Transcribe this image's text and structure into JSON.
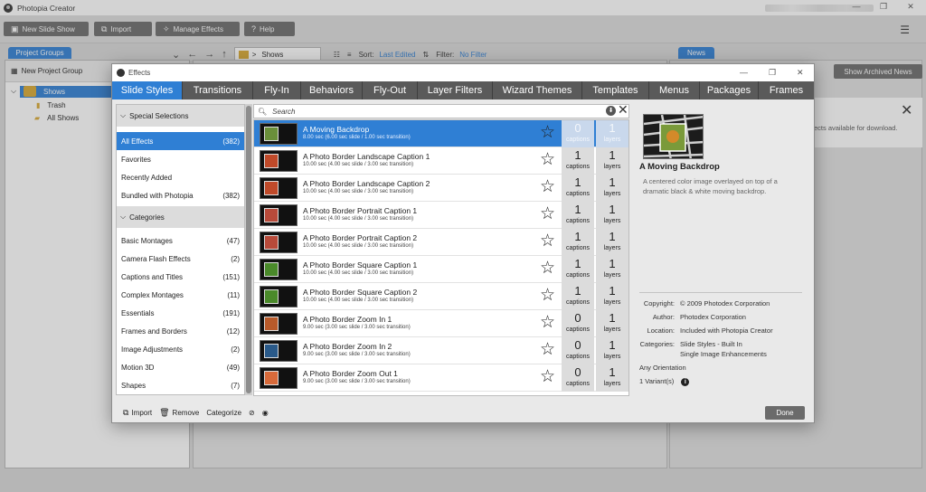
{
  "app": {
    "title": "Photopia Creator",
    "window_controls": {
      "minimize": "—",
      "maximize": "❐",
      "close": "✕"
    }
  },
  "toolbar": {
    "new_slide_show": "New Slide Show",
    "import": "Import",
    "manage_effects": "Manage Effects",
    "help": "Help"
  },
  "left": {
    "tab": "Project Groups",
    "new_group": "New Project Group",
    "tree": [
      {
        "label": "Shows"
      },
      {
        "label": "Trash"
      },
      {
        "label": "All Shows"
      }
    ]
  },
  "center": {
    "path": "Shows",
    "path_sep": ">",
    "sort_label": "Sort:",
    "sort_value": "Last Edited",
    "filter_label": "Filter:",
    "filter_value": "No Filter"
  },
  "news": {
    "tab": "News",
    "show_archived": "Show Archived News",
    "notice_text": "ects available for download."
  },
  "dialog": {
    "title": "Effects",
    "tabs": [
      "Slide Styles",
      "Transitions",
      "Fly-In",
      "Behaviors",
      "Fly-Out",
      "Layer Filters",
      "Wizard Themes",
      "Templates",
      "Menus",
      "Packages",
      "Frames"
    ],
    "special_header": "Special Selections",
    "special": [
      {
        "label": "All Effects",
        "count": "(382)"
      },
      {
        "label": "Favorites",
        "count": ""
      },
      {
        "label": "Recently Added",
        "count": ""
      },
      {
        "label": "Bundled with Photopia",
        "count": "(382)"
      }
    ],
    "categories_header": "Categories",
    "categories": [
      {
        "label": "Basic Montages",
        "count": "(47)"
      },
      {
        "label": "Camera Flash Effects",
        "count": "(2)"
      },
      {
        "label": "Captions and Titles",
        "count": "(151)"
      },
      {
        "label": "Complex Montages",
        "count": "(11)"
      },
      {
        "label": "Essentials",
        "count": "(191)"
      },
      {
        "label": "Frames and Borders",
        "count": "(12)"
      },
      {
        "label": "Image Adjustments",
        "count": "(2)"
      },
      {
        "label": "Motion 3D",
        "count": "(49)"
      },
      {
        "label": "Shapes",
        "count": "(7)"
      }
    ],
    "search_placeholder": "Search",
    "captions_label": "captions",
    "layers_label": "layers",
    "effects": [
      {
        "name": "A Moving Backdrop",
        "desc": "8.00 sec (6.00 sec slide / 1.00 sec transition)",
        "captions": "0",
        "layers": "1"
      },
      {
        "name": "A Photo Border Landscape Caption 1",
        "desc": "10.00 sec (4.00 sec slide / 3.00 sec transition)",
        "captions": "1",
        "layers": "1"
      },
      {
        "name": "A Photo Border Landscape Caption 2",
        "desc": "10.00 sec (4.00 sec slide / 3.00 sec transition)",
        "captions": "1",
        "layers": "1"
      },
      {
        "name": "A Photo Border Portrait Caption 1",
        "desc": "10.00 sec (4.00 sec slide / 3.00 sec transition)",
        "captions": "1",
        "layers": "1"
      },
      {
        "name": "A Photo Border Portrait Caption 2",
        "desc": "10.00 sec (4.00 sec slide / 3.00 sec transition)",
        "captions": "1",
        "layers": "1"
      },
      {
        "name": "A Photo Border Square Caption 1",
        "desc": "10.00 sec (4.00 sec slide / 3.00 sec transition)",
        "captions": "1",
        "layers": "1"
      },
      {
        "name": "A Photo Border Square Caption 2",
        "desc": "10.00 sec (4.00 sec slide / 3.00 sec transition)",
        "captions": "1",
        "layers": "1"
      },
      {
        "name": "A Photo Border Zoom In 1",
        "desc": "9.00 sec (3.00 sec slide / 3.00 sec transition)",
        "captions": "0",
        "layers": "1"
      },
      {
        "name": "A Photo Border Zoom In 2",
        "desc": "9.00 sec (3.00 sec slide / 3.00 sec transition)",
        "captions": "0",
        "layers": "1"
      },
      {
        "name": "A Photo Border Zoom Out 1",
        "desc": "9.00 sec (3.00 sec slide / 3.00 sec transition)",
        "captions": "0",
        "layers": "1"
      }
    ],
    "preview": {
      "title": "A Moving Backdrop",
      "description": "A centered color image overlayed on top of a dramatic black & white moving backdrop.",
      "copyright_label": "Copyright:",
      "copyright": "© 2009 Photodex Corporation",
      "author_label": "Author:",
      "author": "Photodex Corporation",
      "location_label": "Location:",
      "location": "Included with Photopia Creator",
      "categories_label": "Categories:",
      "categories_1": "Slide Styles - Built In",
      "categories_2": "Single Image Enhancements",
      "orientation": "Any Orientation",
      "variants": "1 Variant(s)"
    },
    "footer": {
      "import": "Import",
      "remove": "Remove",
      "categorize": "Categorize",
      "done": "Done"
    }
  },
  "colors": {
    "accent": "#2f7fd4",
    "tabbar": "#5a5a5a",
    "button": "#6b6b6b"
  }
}
